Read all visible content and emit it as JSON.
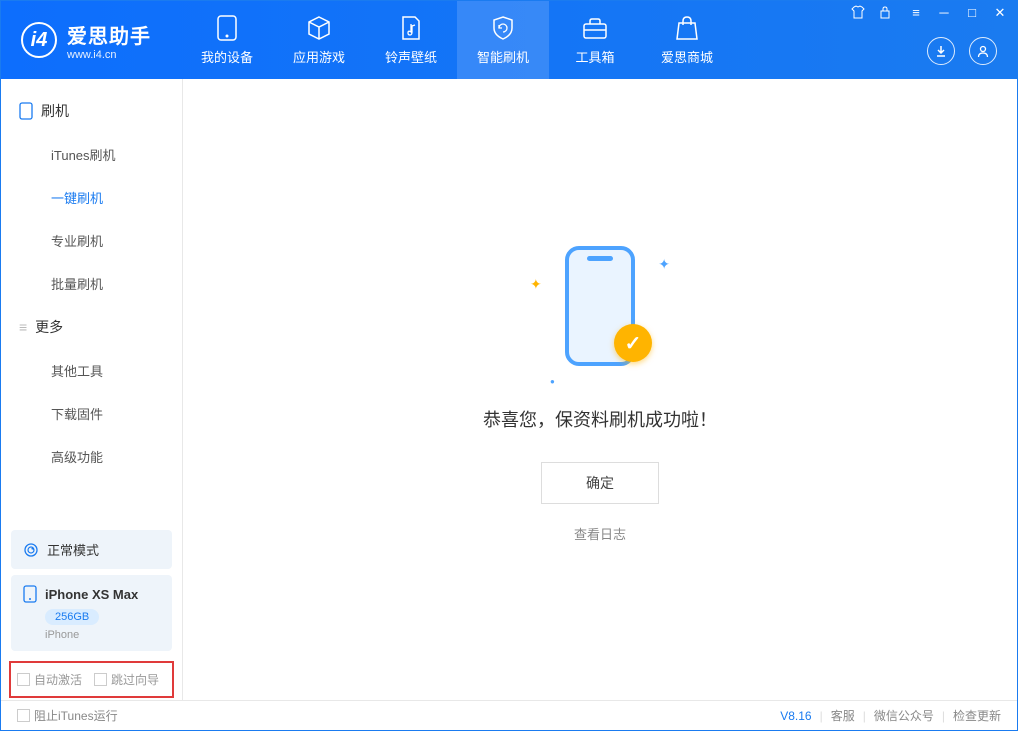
{
  "header": {
    "logo_title": "爱思助手",
    "logo_url": "www.i4.cn",
    "tabs": [
      {
        "label": "我的设备"
      },
      {
        "label": "应用游戏"
      },
      {
        "label": "铃声壁纸"
      },
      {
        "label": "智能刷机"
      },
      {
        "label": "工具箱"
      },
      {
        "label": "爱思商城"
      }
    ]
  },
  "sidebar": {
    "group1_title": "刷机",
    "items1": [
      {
        "label": "iTunes刷机"
      },
      {
        "label": "一键刷机"
      },
      {
        "label": "专业刷机"
      },
      {
        "label": "批量刷机"
      }
    ],
    "group2_title": "更多",
    "items2": [
      {
        "label": "其他工具"
      },
      {
        "label": "下载固件"
      },
      {
        "label": "高级功能"
      }
    ],
    "mode_label": "正常模式",
    "device_name": "iPhone XS Max",
    "device_storage": "256GB",
    "device_type": "iPhone",
    "checkbox1_label": "自动激活",
    "checkbox2_label": "跳过向导"
  },
  "main": {
    "success_message": "恭喜您，保资料刷机成功啦！",
    "confirm_button": "确定",
    "view_log": "查看日志"
  },
  "footer": {
    "block_itunes": "阻止iTunes运行",
    "version": "V8.16",
    "link1": "客服",
    "link2": "微信公众号",
    "link3": "检查更新"
  }
}
